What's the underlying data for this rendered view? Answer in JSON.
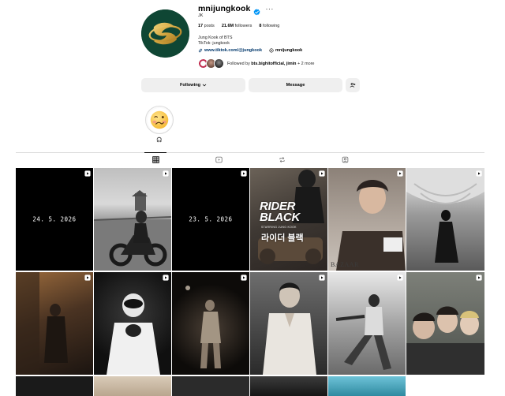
{
  "profile": {
    "username": "mnijungkook",
    "full_name": "JK",
    "verified": true,
    "stats": {
      "posts_count": "17",
      "posts_label": "posts",
      "followers_count": "21.6M",
      "followers_label": "followers",
      "following_count": "8",
      "following_label": "following"
    },
    "bio_lines": [
      "Jung Kook of BTS",
      "TikTok: jungkook"
    ],
    "website": "www.tiktok.com/@jungkook",
    "threads_handle": "mnijungkook",
    "followed_by": {
      "prefix": "Followed by",
      "names": "bts.bighitofficial, jimin",
      "more": "+ 2 more"
    }
  },
  "actions": {
    "following_label": "Following",
    "message_label": "Message"
  },
  "highlights": [
    {
      "label": "🎧",
      "cover_emoji": "🥴"
    }
  ],
  "tabs": [
    {
      "name": "posts",
      "icon": "grid-icon",
      "active": true
    },
    {
      "name": "reels",
      "icon": "reels-icon",
      "active": false
    },
    {
      "name": "reposts",
      "icon": "repost-icon",
      "active": false
    },
    {
      "name": "tagged",
      "icon": "tagged-icon",
      "active": false
    }
  ],
  "grid": {
    "tiles": [
      {
        "kind": "date",
        "text": "24. 5. 2026",
        "reel": true
      },
      {
        "kind": "photo",
        "reel": true
      },
      {
        "kind": "date",
        "text": "23. 5. 2026",
        "reel": true
      },
      {
        "kind": "photo",
        "reel": true,
        "title": "RIDER BLACK",
        "subtitle": "STARRING JUNG KOOK",
        "korean": "라이더 블랙"
      },
      {
        "kind": "photo",
        "reel": true,
        "brand": "BAZAAR"
      },
      {
        "kind": "photo",
        "reel": true
      },
      {
        "kind": "photo",
        "reel": true
      },
      {
        "kind": "photo",
        "reel": true
      },
      {
        "kind": "photo",
        "reel": true
      },
      {
        "kind": "photo",
        "reel": true
      },
      {
        "kind": "photo",
        "reel": true
      },
      {
        "kind": "photo",
        "reel": true
      }
    ]
  },
  "colors": {
    "link": "#00376b",
    "verified": "#0095f6",
    "button_bg": "#efefef",
    "divider": "#dbdbdb"
  }
}
